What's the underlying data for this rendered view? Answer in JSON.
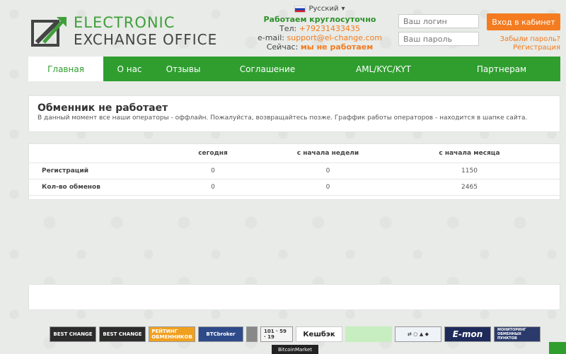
{
  "header": {
    "logo_line1": "ELECTRONIC",
    "logo_line2": "EXCHANGE OFFICE",
    "language": "Русский",
    "hours": "Работаем круглосуточно",
    "phone_label": "Тел:",
    "phone": "+79231433435",
    "email_label": "e-mail:",
    "email": "support@el-change.com",
    "now_label": "Сейчас:",
    "now_status": "мы не работаем",
    "login_placeholder": "Ваш логин",
    "password_placeholder": "Ваш пароль",
    "login_button": "Вход в кабинет",
    "forgot_link": "Забыли пароль?",
    "register_link": "Регистрация"
  },
  "nav": [
    {
      "label": "Главная",
      "active": true
    },
    {
      "label": "О нас"
    },
    {
      "label": "Отзывы"
    },
    {
      "label": "Соглашение"
    },
    {
      "label": "AML/KYC/KYT"
    },
    {
      "label": "Партнерам"
    }
  ],
  "status": {
    "title": "Обменник не работает",
    "message": "В данный момент все наши операторы - оффлайн. Пожалуйста, возвращайтесь позже. Граффик работы операторов - находится в шапке сайта."
  },
  "stats": {
    "headers": [
      "",
      "сегодня",
      "с начала недели",
      "с начала месяца"
    ],
    "rows": [
      {
        "label": "Регистраций",
        "today": "0",
        "week": "0",
        "month": "1150"
      },
      {
        "label": "Кол-во обменов",
        "today": "0",
        "week": "0",
        "month": "2465"
      }
    ]
  },
  "partners": {
    "bestchange1": "BEST CHANGE",
    "bestchange2": "BEST CHANGE",
    "rating": "РЕЙТИНГ ОБМЕННИКОВ",
    "btcbroker": "BTCbroker",
    "cashback": "Кешбэк",
    "emon": "E-mon",
    "monitoring": "МОНИТОРИНГ ОБМЕННЫХ ПУНКТОВ",
    "bitcoinmarket": "BitcoinMarket"
  },
  "colors": {
    "brand_green": "#2f9e2f",
    "accent_orange": "#f47b20"
  }
}
